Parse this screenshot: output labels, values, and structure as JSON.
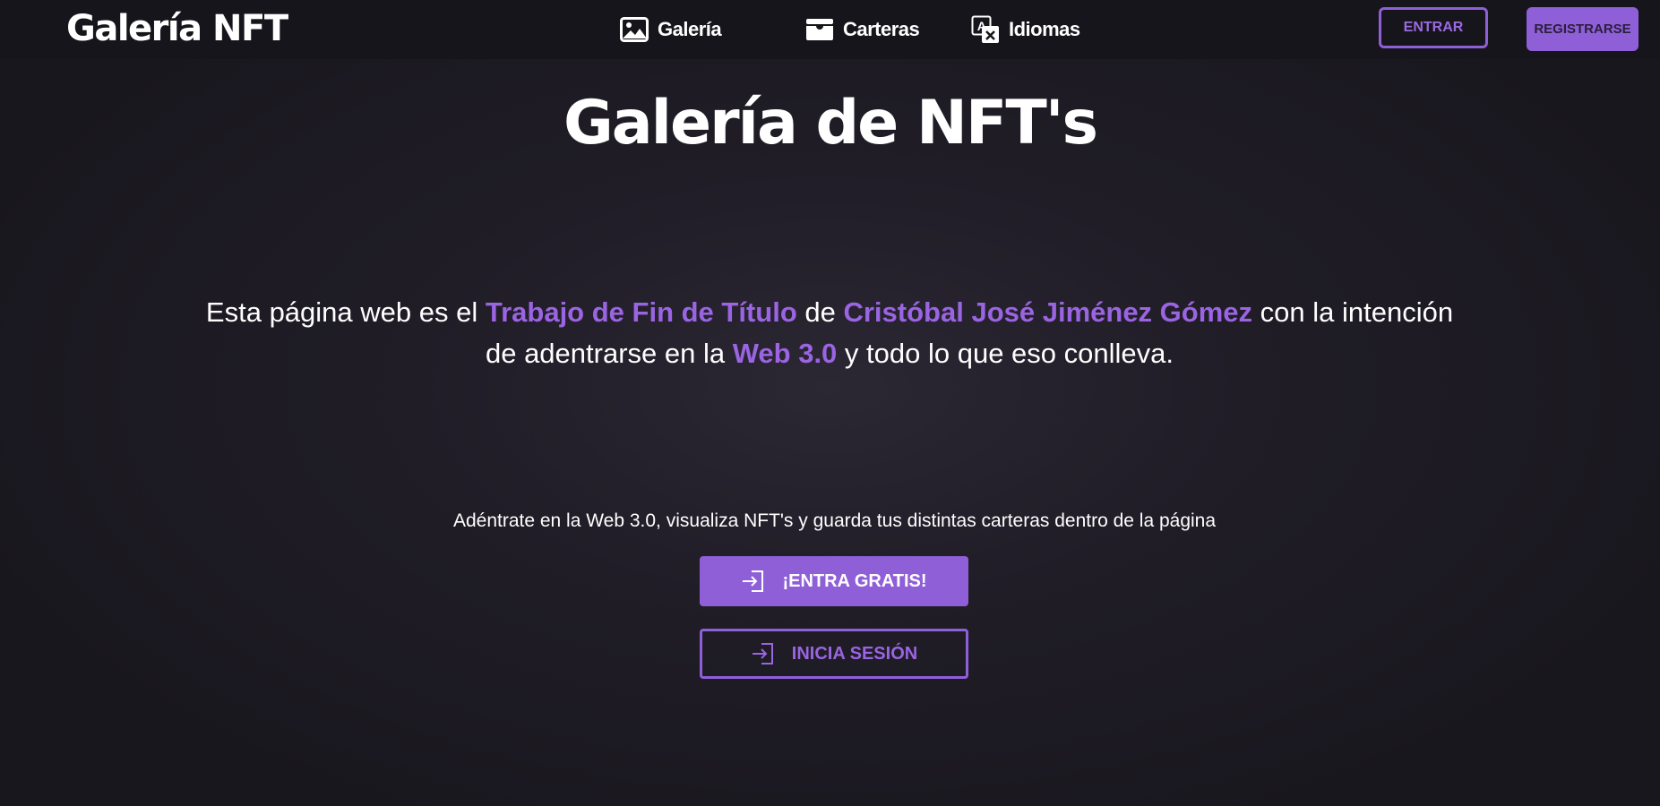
{
  "header": {
    "logo": "Galería NFT",
    "nav": [
      {
        "label": "Galería",
        "icon": "image-icon"
      },
      {
        "label": "Carteras",
        "icon": "wallet-icon"
      },
      {
        "label": "Idiomas",
        "icon": "translate-icon"
      }
    ],
    "login_label": "ENTRAR",
    "register_label": "REGISTRARSE"
  },
  "hero": {
    "title": "Galería de NFT's",
    "intro": {
      "p1": "Esta página web es el ",
      "h1": "Trabajo de Fin de Título",
      "p2": " de ",
      "h2": "Cristóbal José Jiménez Gómez",
      "p3": " con la intención de adentrarse en la ",
      "h3": "Web 3.0",
      "p4": " y todo lo que eso conlleva."
    },
    "cta_text": "Adéntrate en la Web 3.0, visualiza NFT's y guarda tus distintas carteras dentro de la página",
    "primary_button": "¡ENTRA GRATIS!",
    "secondary_button": "INICIA SESIÓN"
  },
  "colors": {
    "accent": "#8f5fd8",
    "highlight_text": "#9a64e2",
    "header_bg": "#17151c",
    "page_bg": "#1e1b24"
  }
}
